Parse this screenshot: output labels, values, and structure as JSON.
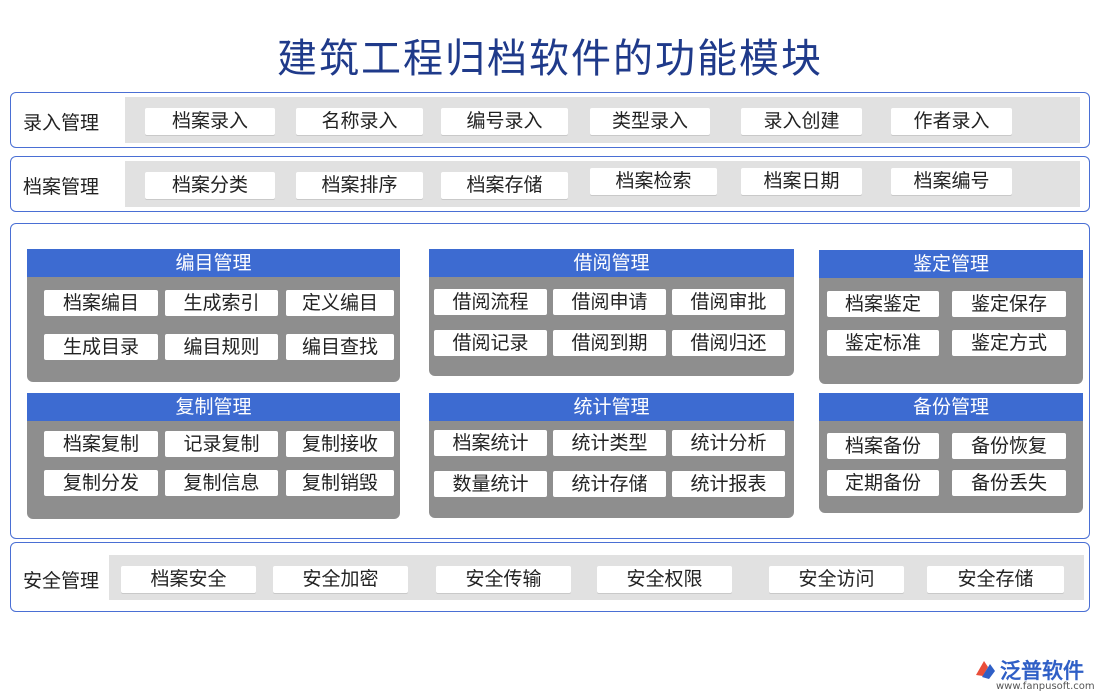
{
  "title": "建筑工程归档软件的功能模块",
  "rows": {
    "entry": {
      "label": "录入管理",
      "items": [
        "档案录入",
        "名称录入",
        "编号录入",
        "类型录入",
        "录入创建",
        "作者录入"
      ]
    },
    "archive": {
      "label": "档案管理",
      "items": [
        "档案分类",
        "档案排序",
        "档案存储",
        "档案检索",
        "档案日期",
        "档案编号"
      ]
    },
    "security": {
      "label": "安全管理",
      "items": [
        "档案安全",
        "安全加密",
        "安全传输",
        "安全权限",
        "安全访问",
        "安全存储"
      ]
    }
  },
  "modules": {
    "catalog": {
      "title": "编目管理",
      "items": [
        "档案编目",
        "生成索引",
        "定义编目",
        "生成目录",
        "编目规则",
        "编目查找"
      ]
    },
    "borrow": {
      "title": "借阅管理",
      "items": [
        "借阅流程",
        "借阅申请",
        "借阅审批",
        "借阅记录",
        "借阅到期",
        "借阅归还"
      ]
    },
    "appraisal": {
      "title": "鉴定管理",
      "items": [
        "档案鉴定",
        "鉴定保存",
        "鉴定标准",
        "鉴定方式"
      ]
    },
    "copy": {
      "title": "复制管理",
      "items": [
        "档案复制",
        "记录复制",
        "复制接收",
        "复制分发",
        "复制信息",
        "复制销毁"
      ]
    },
    "stats": {
      "title": "统计管理",
      "items": [
        "档案统计",
        "统计类型",
        "统计分析",
        "数量统计",
        "统计存储",
        "统计报表"
      ]
    },
    "backup": {
      "title": "备份管理",
      "items": [
        "档案备份",
        "备份恢复",
        "定期备份",
        "备份丢失"
      ]
    }
  },
  "logo": {
    "name": "泛普软件",
    "url": "www.fanpusoft.com"
  },
  "colors": {
    "accent": "#3d6bd1",
    "border": "#4a6fd4",
    "module_bg": "#8e8e8e",
    "bar_bg": "#e1e1e1"
  }
}
